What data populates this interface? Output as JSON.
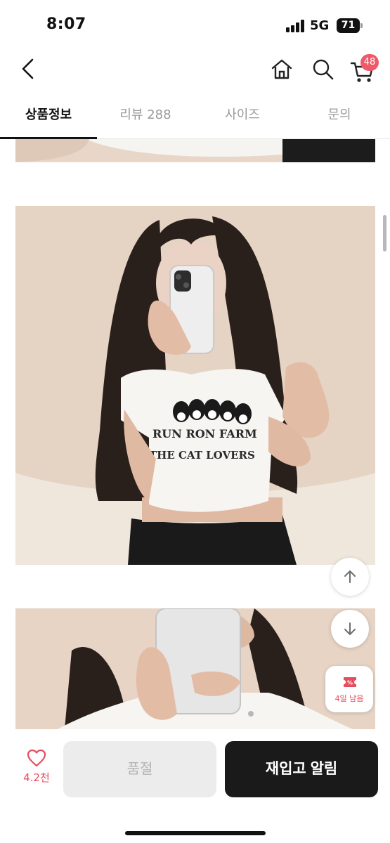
{
  "status": {
    "time": "8:07",
    "network": "5G",
    "battery": "71"
  },
  "header": {
    "cart_count": "48"
  },
  "tabs": [
    {
      "label": "상품정보",
      "active": true
    },
    {
      "label": "리뷰 288",
      "active": false
    },
    {
      "label": "사이즈",
      "active": false
    },
    {
      "label": "문의",
      "active": false
    }
  ],
  "photo": {
    "shirt_print": [
      "RUN RON FARM",
      "THE CAT LOVERS"
    ]
  },
  "coupon": {
    "label": "4일 남음"
  },
  "bottom_bar": {
    "like_count": "4.2천",
    "soldout_label": "품절",
    "restock_label": "재입고 알림"
  },
  "colors": {
    "accent": "#e64d5f",
    "badge": "#ef5a6b",
    "primary_button": "#1a1a1a",
    "disabled_button": "#ececec"
  },
  "icons": [
    "back-arrow-icon",
    "home-icon",
    "search-icon",
    "cart-icon",
    "scroll-up-icon",
    "scroll-down-icon",
    "coupon-icon",
    "heart-icon"
  ]
}
